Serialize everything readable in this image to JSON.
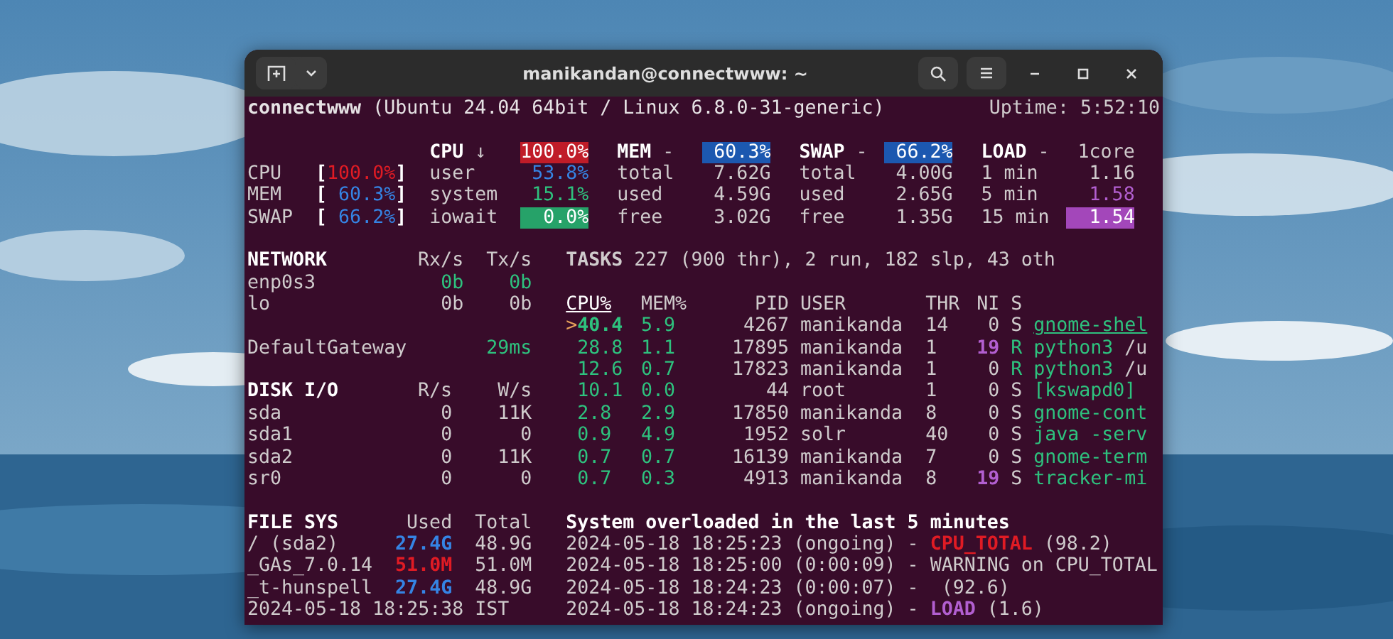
{
  "window": {
    "title": "manikandan@connectwww: ~"
  },
  "header": {
    "system": "**connectwww** (Ubuntu 24.04 64bit / Linux 6.8.0-31-generic)",
    "uptime": "Uptime: 5:52:10"
  },
  "quicklook": [
    {
      "label": "CPU",
      "open": "[",
      "value": "100.0%",
      "close": "]",
      "color": "#e01b24"
    },
    {
      "label": "MEM",
      "open": "[",
      "value": " 60.3%",
      "close": "]",
      "color": "#3584e4"
    },
    {
      "label": "SWAP",
      "open": "[",
      "value": " 66.2%",
      "close": "]",
      "color": "#3584e4"
    }
  ],
  "summary": [
    {
      "title": "CPU",
      "mark": "↓",
      "value": "100.0%",
      "color": "#c01c28",
      "highlight": true,
      "rows": [
        {
          "label": "user",
          "value": "53.8%",
          "color": "#3584e4",
          "highlight": false
        },
        {
          "label": "system",
          "value": "15.1%",
          "color": "#2ec27e",
          "highlight": false
        },
        {
          "label": "iowait",
          "value": "0.0%",
          "color": "#26a269",
          "highlight": true
        }
      ]
    },
    {
      "title": "MEM",
      "mark": "-",
      "value": "60.3%",
      "color": "#1c58b0",
      "highlight": true,
      "rows": [
        {
          "label": "total",
          "value": "7.62G",
          "color": "#cfcbcc",
          "highlight": false
        },
        {
          "label": "used",
          "value": "4.59G",
          "color": "#cfcbcc",
          "highlight": false
        },
        {
          "label": "free",
          "value": "3.02G",
          "color": "#cfcbcc",
          "highlight": false
        }
      ]
    },
    {
      "title": "SWAP",
      "mark": "-",
      "value": "66.2%",
      "color": "#1c58b0",
      "highlight": true,
      "rows": [
        {
          "label": "total",
          "value": "4.00G",
          "color": "#cfcbcc",
          "highlight": false
        },
        {
          "label": "used",
          "value": "2.65G",
          "color": "#cfcbcc",
          "highlight": false
        },
        {
          "label": "free",
          "value": "1.35G",
          "color": "#cfcbcc",
          "highlight": false
        }
      ]
    },
    {
      "title": "LOAD",
      "mark": "-",
      "value": "1core",
      "color": "#cfcbcc",
      "highlight": false,
      "rows": [
        {
          "label": "1 min",
          "value": "1.16",
          "color": "#cfcbcc",
          "highlight": false
        },
        {
          "label": "5 min",
          "value": "1.58",
          "color": "#b25fd0",
          "highlight": false
        },
        {
          "label": "15 min",
          "value": "1.54",
          "color": "#a347ba",
          "highlight": true
        }
      ]
    }
  ],
  "network": {
    "title": "NETWORK",
    "columns": [
      "Rx/s",
      "Tx/s"
    ],
    "rows": [
      {
        "name": "enp0s3",
        "values": [
          "0b",
          "0b"
        ],
        "color": "#2ec27e"
      },
      {
        "name": "lo",
        "values": [
          "0b",
          "0b"
        ],
        "color": "#cfcbcc"
      }
    ]
  },
  "gateway": {
    "name": "DefaultGateway",
    "value": "29ms"
  },
  "disk": {
    "title": "DISK I/O",
    "columns": [
      "R/s",
      "W/s"
    ],
    "rows": [
      {
        "name": "sda",
        "values": [
          "0",
          "11K"
        ]
      },
      {
        "name": "sda1",
        "values": [
          "0",
          "0"
        ]
      },
      {
        "name": "sda2",
        "values": [
          "0",
          "11K"
        ]
      },
      {
        "name": "sr0",
        "values": [
          "0",
          "0"
        ]
      }
    ]
  },
  "filesys": {
    "title": "FILE SYS",
    "columns": [
      "Used",
      "Total"
    ],
    "rows": [
      {
        "name": "/ (sda2)",
        "used": "27.4G",
        "total": "48.9G",
        "color": "#3584e4"
      },
      {
        "name": "_GAs_7.0.14",
        "used": "51.0M",
        "total": "51.0M",
        "color": "#e01b24"
      },
      {
        "name": "_t-hunspell",
        "used": "27.4G",
        "total": "48.9G",
        "color": "#3584e4"
      }
    ]
  },
  "clock": "2024-05-18 18:25:38 IST",
  "tasks": "**TASKS** 227 (900 thr), 2 run, 182 slp, 43 oth",
  "processes": {
    "columns": [
      {
        "label": "CPU%",
        "sorted": true
      },
      {
        "label": "MEM%",
        "sorted": false
      },
      {
        "label": "PID",
        "sorted": false
      },
      {
        "label": "USER",
        "sorted": false
      },
      {
        "label": "THR",
        "sorted": false
      },
      {
        "label": "NI",
        "sorted": false
      },
      {
        "label": "S",
        "sorted": false
      }
    ],
    "rows": [
      {
        "marker": ">",
        "cpu": "40.4",
        "mem": "5.9",
        "pid": "4267",
        "user": "manikanda",
        "thr": "14",
        "ni": "0",
        "niced": false,
        "state": "S",
        "running": false,
        "command": "gnome-shel",
        "selected": true
      },
      {
        "cpu": "28.8",
        "mem": "1.1",
        "pid": "17895",
        "user": "manikanda",
        "thr": "1",
        "ni": "19",
        "niced": true,
        "state": "R",
        "running": true,
        "command": "python3",
        "args": " /u",
        "selected": false
      },
      {
        "cpu": "12.6",
        "mem": "0.7",
        "pid": "17823",
        "user": "manikanda",
        "thr": "1",
        "ni": "0",
        "niced": false,
        "state": "R",
        "running": true,
        "command": "python3",
        "args": " /u",
        "selected": false
      },
      {
        "cpu": "10.1",
        "mem": "0.0",
        "pid": "44",
        "user": "root",
        "thr": "1",
        "ni": "0",
        "niced": false,
        "state": "S",
        "running": false,
        "command": "[kswapd0]",
        "selected": false
      },
      {
        "cpu": "2.8",
        "mem": "2.9",
        "pid": "17850",
        "user": "manikanda",
        "thr": "8",
        "ni": "0",
        "niced": false,
        "state": "S",
        "running": false,
        "command": "gnome-cont",
        "selected": false
      },
      {
        "cpu": "0.9",
        "mem": "4.9",
        "pid": "1952",
        "user": "solr",
        "thr": "40",
        "ni": "0",
        "niced": false,
        "state": "S",
        "running": false,
        "command": "java -serv",
        "selected": false
      },
      {
        "cpu": "0.7",
        "mem": "0.7",
        "pid": "16139",
        "user": "manikanda",
        "thr": "7",
        "ni": "0",
        "niced": false,
        "state": "S",
        "running": false,
        "command": "gnome-term",
        "selected": false
      },
      {
        "cpu": "0.7",
        "mem": "0.3",
        "pid": "4913",
        "user": "manikanda",
        "thr": "8",
        "ni": "19",
        "niced": true,
        "state": "S",
        "running": false,
        "command": "tracker-mi",
        "selected": false
      }
    ]
  },
  "alerts": {
    "title": "System overloaded in the last 5 minutes",
    "items": [
      {
        "text": "2024-05-18 18:25:23 (ongoing) - ",
        "metric": "CPU_TOTAL",
        "color": "#e01b24",
        "value": " (98.2)"
      },
      {
        "text": "2024-05-18 18:25:00 (0:00:09) - WARNING on CPU_TOTAL"
      },
      {
        "text": "2024-05-18 18:24:23 (0:00:07) -  (92.6)"
      },
      {
        "text": "2024-05-18 18:24:23 (ongoing) - ",
        "metric": "LOAD",
        "color": "#b25fd0",
        "value": " (1.6)"
      }
    ]
  }
}
